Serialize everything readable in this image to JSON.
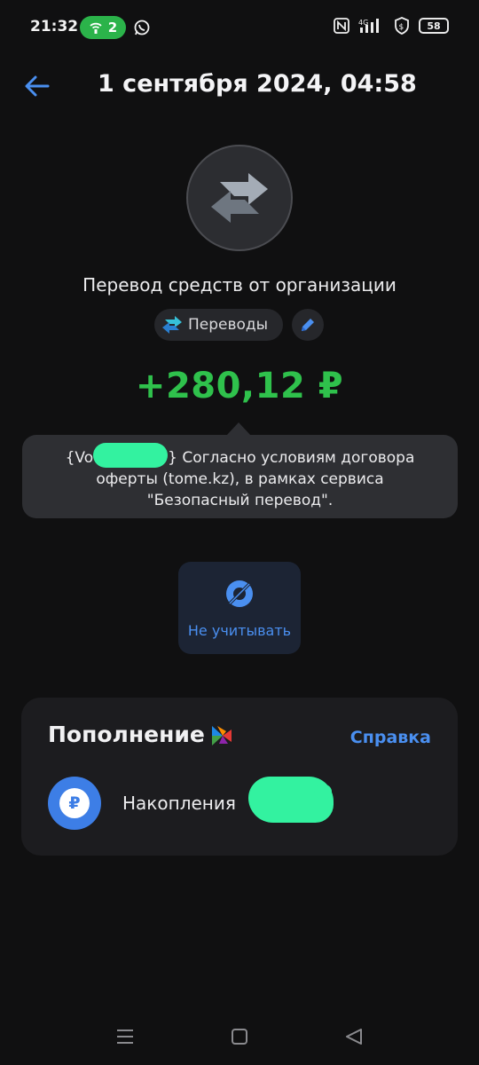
{
  "status_bar": {
    "time": "21:32",
    "hotspot_count": "2",
    "network": "4G",
    "battery": "58"
  },
  "header": {
    "title": "1 сентября 2024, 04:58"
  },
  "operation": {
    "name": "Перевод средств от организации",
    "category": "Переводы",
    "amount": "+280,12 ₽",
    "amount_color": "#2fc14c",
    "description_prefix": "{Vo",
    "description_suffix": "} Согласно условиям договора оферты (tome.kz), в рамках сервиса \"Безопасный перевод\"."
  },
  "actions": {
    "ignore_label": "Не учитывать"
  },
  "replenish": {
    "title": "Пополнение",
    "help_label": "Справка",
    "account_name": "Накопления"
  },
  "colors": {
    "accent_blue": "#4a8ff0",
    "redaction": "#33f2a0",
    "background": "#101011"
  },
  "icons": {
    "back": "arrow-left-icon",
    "category": "exchange-arrows-icon",
    "edit": "pencil-icon",
    "ignore": "eye-off-icon",
    "brand": "colored-triangles-icon",
    "account": "ruble-coin-icon"
  }
}
